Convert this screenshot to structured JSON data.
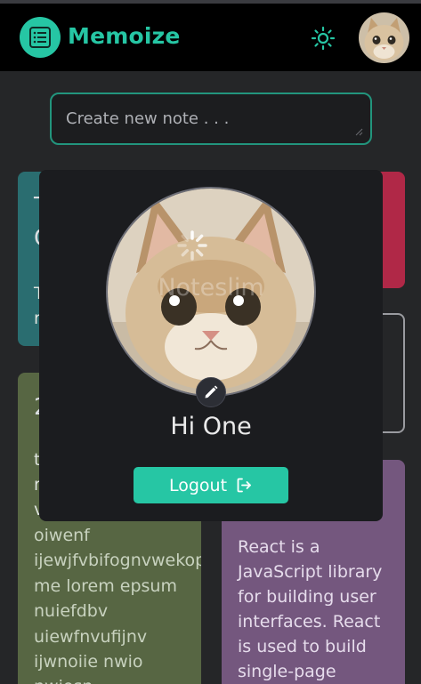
{
  "header": {
    "app_title": "Memoize",
    "logo_icon": "notes-list-icon",
    "theme_icon": "sun-icon",
    "accent_color": "#26c6a4"
  },
  "composer": {
    "placeholder": "Create new note . . ."
  },
  "notes": {
    "teal": {
      "title_letter_1": "T",
      "title_letter_2": "C",
      "body_letter_1": "T",
      "body_letter_2": "r"
    },
    "olive": {
      "title_letter": "2",
      "left_letters": [
        "t",
        "r",
        "v"
      ],
      "lines": [
        "oiwenf",
        "ijewjfvbifognvwekop",
        "me lorem epsum",
        "nuiefdbv",
        "uiewfnvufijnv",
        "ijwnoiie nwio",
        "nwiosn"
      ]
    },
    "purple": {
      "lines": [
        "React is a",
        "JavaScript library",
        "for building user",
        "interfaces. React",
        "is used to build",
        "single-page"
      ]
    }
  },
  "profile_popup": {
    "greeting": "Hi One",
    "logout_label": "Logout",
    "watermark": "Noteslim"
  }
}
